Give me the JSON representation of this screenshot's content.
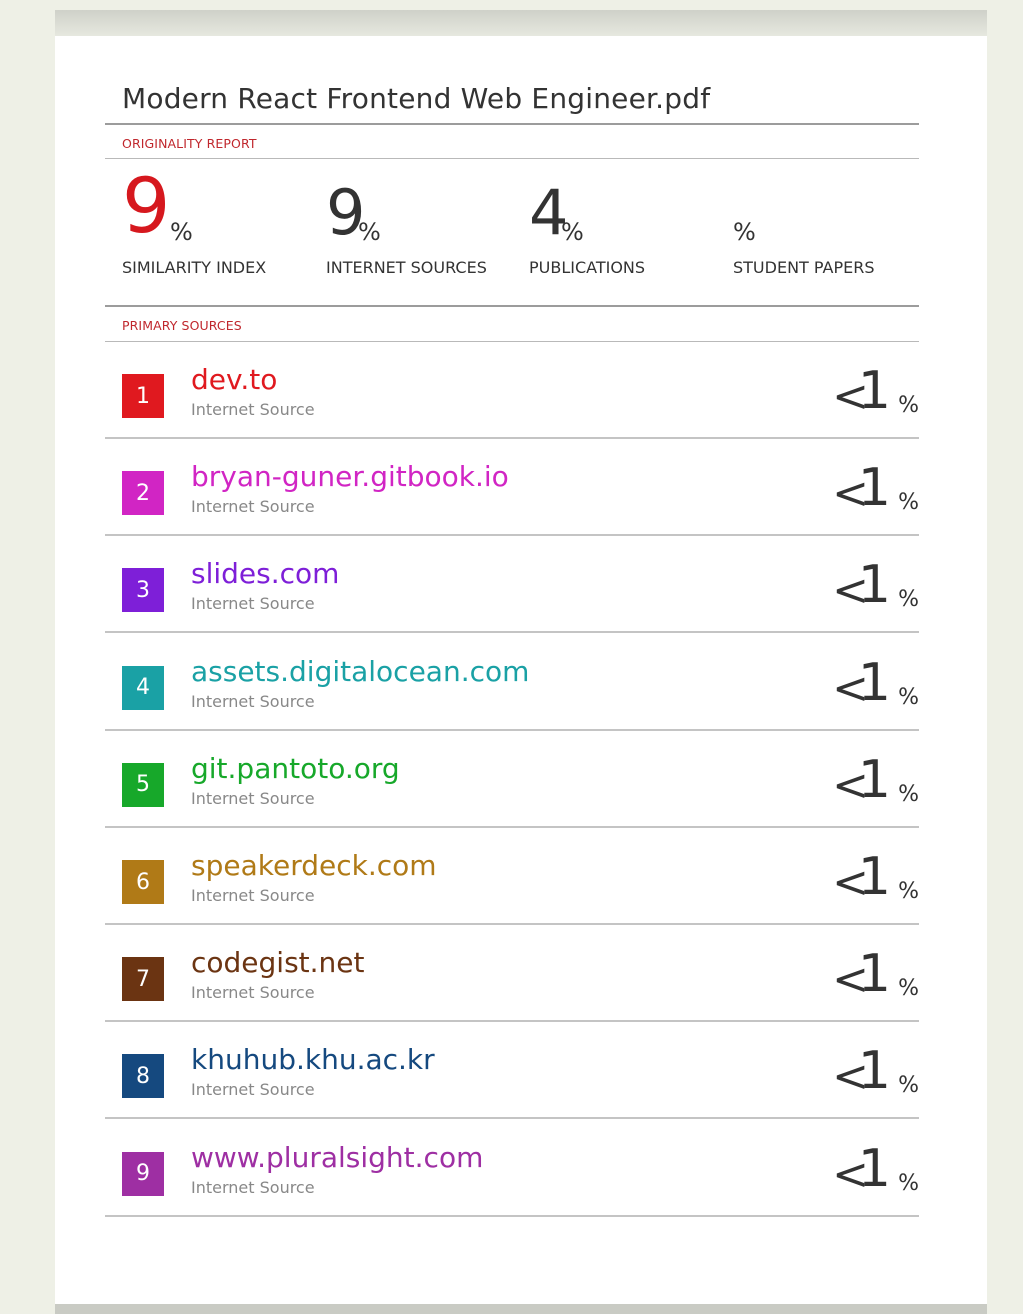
{
  "document": {
    "title": "Modern React Frontend Web Engineer.pdf"
  },
  "report": {
    "originality_label": "ORIGINALITY REPORT",
    "primary_sources_label": "PRIMARY SOURCES",
    "stats": [
      {
        "value": "9",
        "unit": "%",
        "label": "SIMILARITY INDEX"
      },
      {
        "value": "9",
        "unit": "%",
        "label": "INTERNET SOURCES"
      },
      {
        "value": "4",
        "unit": "%",
        "label": "PUBLICATIONS"
      },
      {
        "value": "",
        "unit": "%",
        "label": "STUDENT PAPERS"
      }
    ],
    "accent_color": "#d6181e"
  },
  "sources": [
    {
      "rank": "1",
      "name": "dev.to",
      "type": "Internet Source",
      "match_prefix": "<",
      "match_value": "1",
      "match_unit": "%",
      "color": "#e0191f"
    },
    {
      "rank": "2",
      "name": "bryan-guner.gitbook.io",
      "type": "Internet Source",
      "match_prefix": "<",
      "match_value": "1",
      "match_unit": "%",
      "color": "#d125c4"
    },
    {
      "rank": "3",
      "name": "slides.com",
      "type": "Internet Source",
      "match_prefix": "<",
      "match_value": "1",
      "match_unit": "%",
      "color": "#7e1fd8"
    },
    {
      "rank": "4",
      "name": "assets.digitalocean.com",
      "type": "Internet Source",
      "match_prefix": "<",
      "match_value": "1",
      "match_unit": "%",
      "color": "#1aa1a5"
    },
    {
      "rank": "5",
      "name": "git.pantoto.org",
      "type": "Internet Source",
      "match_prefix": "<",
      "match_value": "1",
      "match_unit": "%",
      "color": "#17a82a"
    },
    {
      "rank": "6",
      "name": "speakerdeck.com",
      "type": "Internet Source",
      "match_prefix": "<",
      "match_value": "1",
      "match_unit": "%",
      "color": "#b07a17"
    },
    {
      "rank": "7",
      "name": "codegist.net",
      "type": "Internet Source",
      "match_prefix": "<",
      "match_value": "1",
      "match_unit": "%",
      "color": "#6b3412"
    },
    {
      "rank": "8",
      "name": "khuhub.khu.ac.kr",
      "type": "Internet Source",
      "match_prefix": "<",
      "match_value": "1",
      "match_unit": "%",
      "color": "#15497f"
    },
    {
      "rank": "9",
      "name": "www.pluralsight.com",
      "type": "Internet Source",
      "match_prefix": "<",
      "match_value": "1",
      "match_unit": "%",
      "color": "#9e2fa3"
    }
  ]
}
